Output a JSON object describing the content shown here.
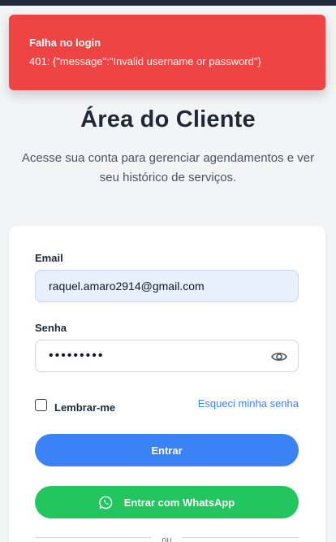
{
  "toast": {
    "title": "Falha no login",
    "message": "401: {\"message\":\"Invalid username or password\"}"
  },
  "header": {
    "title": "Área do Cliente",
    "subtitle": "Acesse sua conta para gerenciar agendamentos e ver seu histórico de serviços."
  },
  "form": {
    "email_label": "Email",
    "email_value": "raquel.amaro2914@gmail.com",
    "password_label": "Senha",
    "password_value": "•••••••••",
    "remember_label": "Lembrar-me",
    "forgot_label": "Esqueci minha senha",
    "submit_label": "Entrar",
    "whatsapp_label": "Entrar com WhatsApp",
    "divider_label": "ou"
  },
  "colors": {
    "error": "#ef4444",
    "primary": "#3b82f6",
    "whatsapp": "#22c55e"
  },
  "icons": {
    "password_toggle": "eye-icon",
    "whatsapp": "whatsapp-icon"
  }
}
